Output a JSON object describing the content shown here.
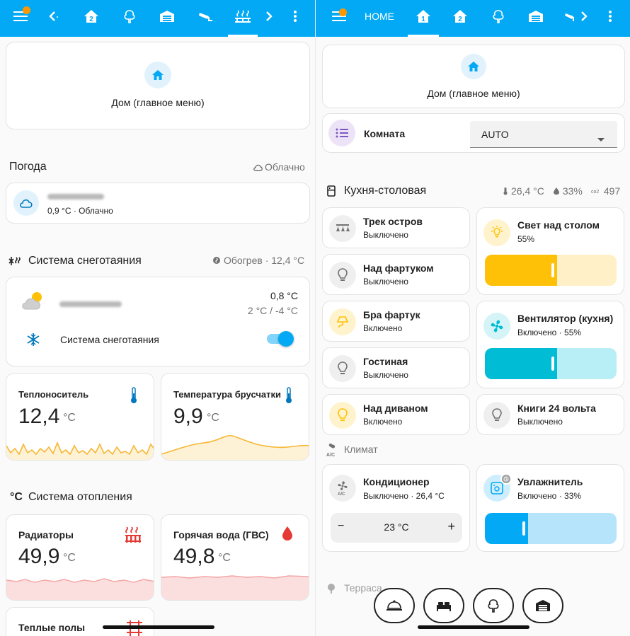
{
  "colors": {
    "header": "#03a9f4",
    "accent_dot": "#ff9800",
    "amber": "#ffc107",
    "teal": "#00bcd4",
    "blue": "#03a9f4",
    "red": "#e53935",
    "thermo": "#0277bd"
  },
  "left": {
    "header_icons": [
      "menu-icon",
      "chevron-left-icon",
      "floor-2-icon",
      "tree-icon",
      "garage-icon",
      "cctv-icon",
      "snow-melt-icon",
      "chevron-right-icon",
      "more-vert-icon"
    ],
    "home_card": {
      "label": "Дом (главное меню)"
    },
    "weather": {
      "title": "Погода",
      "condition_badge": "Облачно",
      "temp_line": "0,9 °C · Облачно"
    },
    "snow": {
      "title": "Система снеготаяния",
      "status": "Обогрев · 12,4 °C",
      "temp_now": "0,8 °C",
      "temp_range": "2 °C / -4 °C",
      "switch_label": "Система снеготаяния",
      "switch_on": true
    },
    "sensor_coolant": {
      "name": "Теплоноситель",
      "value": "12,4",
      "unit": "°C"
    },
    "sensor_paving": {
      "name": "Температура брусчатки",
      "value": "9,9",
      "unit": "°C"
    },
    "heating": {
      "title": "Система отопления",
      "title_icon": "°C"
    },
    "sensor_radiators": {
      "name": "Радиаторы",
      "value": "49,9",
      "unit": "°C"
    },
    "sensor_hot_water": {
      "name": "Горячая вода (ГВС)",
      "value": "49,8",
      "unit": "°C"
    },
    "sensor_floor": {
      "name": "Теплые полы"
    }
  },
  "right": {
    "header": {
      "home_label": "HOME"
    },
    "home_card": {
      "label": "Дом (главное меню)"
    },
    "room_select": {
      "label": "Комната",
      "value": "AUTO"
    },
    "kitchen": {
      "title": "Кухня-столовая",
      "temperature": "26,4 °C",
      "humidity": "33%",
      "co2": "497"
    },
    "tiles": [
      {
        "name": "Трек остров",
        "state": "Выключено",
        "icon": "track-light-icon"
      },
      {
        "name": "Над фартуком",
        "state": "Выключено",
        "icon": "bulb-icon"
      },
      {
        "name": "Бра фартук",
        "state": "Включено",
        "icon": "wall-lamp-icon"
      },
      {
        "name": "Гостиная",
        "state": "Выключено",
        "icon": "bulb-icon"
      },
      {
        "name": "Над диваном",
        "state": "Включено",
        "icon": "bulb-icon"
      },
      {
        "name": "Книги 24 вольта",
        "state": "Выключено",
        "icon": "bulb-icon"
      }
    ],
    "light_table": {
      "name": "Свет над столом",
      "state": "55%",
      "brightness_pct": 55
    },
    "fan": {
      "name": "Вентилятор (кухня)",
      "state": "Включено · 55%",
      "speed_pct": 55
    },
    "climate": {
      "title": "Климат"
    },
    "ac": {
      "name": "Кондиционер",
      "state": "Выключено · 26,4 °C",
      "target": "23 °C",
      "minus": "−",
      "plus": "+"
    },
    "humidifier": {
      "name": "Увлажнитель",
      "state": "Включено · 33%",
      "level_pct": 33
    },
    "terrace": {
      "title": "Терраса"
    },
    "bottom_nav": [
      "table-service-icon",
      "bed-icon",
      "tree-icon",
      "garage-icon"
    ]
  }
}
